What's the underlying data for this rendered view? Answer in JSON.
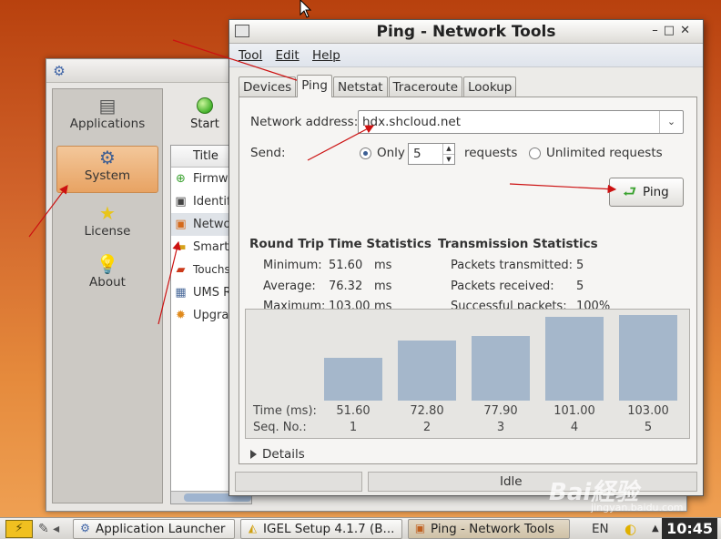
{
  "launcher": {
    "sidebar": [
      {
        "label": "Applications",
        "icon": "applications-icon"
      },
      {
        "label": "System",
        "icon": "gear-icon"
      },
      {
        "label": "License",
        "icon": "star-icon"
      },
      {
        "label": "About",
        "icon": "bulb-icon"
      }
    ],
    "start_label": "Start",
    "list_header": "Title",
    "list_items": [
      {
        "label": "Firmwa",
        "icon": "firmware-icon"
      },
      {
        "label": "Identifi",
        "icon": "monitor-icon"
      },
      {
        "label": "Netwo",
        "icon": "network-icon"
      },
      {
        "label": "Smart",
        "icon": "smartcard-icon"
      },
      {
        "label": "Touchs",
        "icon": "touchscreen-icon"
      },
      {
        "label": "UMS R",
        "icon": "ums-icon"
      },
      {
        "label": "Upgra",
        "icon": "upgrade-icon"
      }
    ]
  },
  "ping_window": {
    "title": "Ping - Network Tools",
    "menu": [
      "Tool",
      "Edit",
      "Help"
    ],
    "tabs": [
      "Devices",
      "Ping",
      "Netstat",
      "Traceroute",
      "Lookup"
    ],
    "active_tab": "Ping",
    "network_address_label": "Network address:",
    "network_address_value": "hdx.shcloud.net",
    "send_label": "Send:",
    "only_label": "Only",
    "requests_value": "5",
    "requests_label": "requests",
    "unlimited_label": "Unlimited requests",
    "ping_button": "Ping",
    "rtt": {
      "heading": "Round Trip Time Statistics",
      "minimum_label": "Minimum:",
      "minimum_value": "51.60",
      "minimum_unit": "ms",
      "average_label": "Average:",
      "average_value": "76.32",
      "average_unit": "ms",
      "maximum_label": "Maximum:",
      "maximum_value": "103.00",
      "maximum_unit": "ms"
    },
    "trans": {
      "heading": "Transmission Statistics",
      "transmitted_label": "Packets transmitted:",
      "transmitted_value": "5",
      "received_label": "Packets received:",
      "received_value": "5",
      "successful_label": "Successful packets:",
      "successful_value": "100%"
    },
    "graph": {
      "time_label": "Time (ms):",
      "seq_label": "Seq. No.:",
      "times": [
        "51.60",
        "72.80",
        "77.90",
        "101.00",
        "103.00"
      ],
      "seqs": [
        "1",
        "2",
        "3",
        "4",
        "5"
      ]
    },
    "details_label": "Details",
    "status": "Idle"
  },
  "chart_data": {
    "type": "bar",
    "categories": [
      "1",
      "2",
      "3",
      "4",
      "5"
    ],
    "values": [
      51.6,
      72.8,
      77.9,
      101.0,
      103.0
    ],
    "title": "",
    "xlabel": "Seq. No.:",
    "ylabel": "Time (ms):",
    "ylim": [
      0,
      103
    ]
  },
  "taskbar": {
    "items": [
      {
        "label": "Application Launcher",
        "icon": "gear-icon"
      },
      {
        "label": "IGEL Setup 4.1.7 (B...",
        "icon": "igel-icon"
      },
      {
        "label": "Ping - Network Tools",
        "icon": "window-icon"
      }
    ],
    "language": "EN",
    "clock": "10:45"
  },
  "watermark": {
    "main": "Bai経验",
    "sub": "jingyan.baidu.com"
  },
  "colors": {
    "bar": "#a5b7cb",
    "annotation_arrow": "#cc1111",
    "active_sidebar": "#e8a363"
  }
}
